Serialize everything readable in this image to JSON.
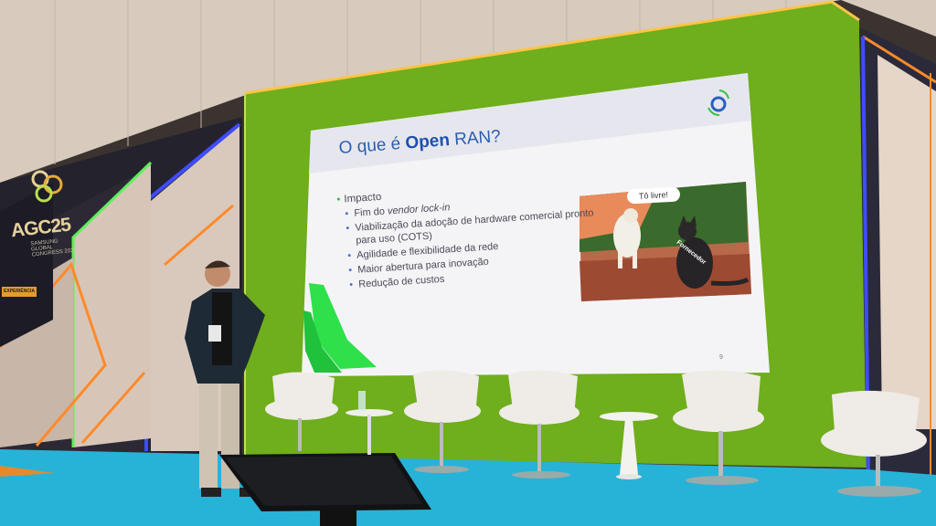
{
  "slide": {
    "title_prefix": "O que é ",
    "title_bold": "Open",
    "title_suffix": " RAN?",
    "bullet_heading": "Impacto",
    "items": [
      {
        "text": "Fim do ",
        "em": "vendor lock-in"
      },
      {
        "text": "Viabilização da adoção de hardware comercial pronto para uso (COTS)"
      },
      {
        "text": "Agilidade e flexibilidade da rede"
      },
      {
        "text": "Maior abertura para inovação"
      },
      {
        "text": "Redução de custos"
      }
    ],
    "speech_bubble": "Tô livre!",
    "cat_label": "Fornecedor",
    "page_number": "9"
  },
  "event_logo": {
    "name": "AGC25",
    "subtitle": "SAMSUNG GLOBAL CONGRESS 2025",
    "badge": "EXPERIÊNCIA"
  },
  "colors": {
    "stage_green": "#6fae1c",
    "floor_blue": "#27b3d8",
    "slide_accent": "#2a5db0",
    "neon_orange": "#ff8a2a",
    "neon_green": "#5ef05a",
    "neon_blue": "#3f4cff"
  }
}
